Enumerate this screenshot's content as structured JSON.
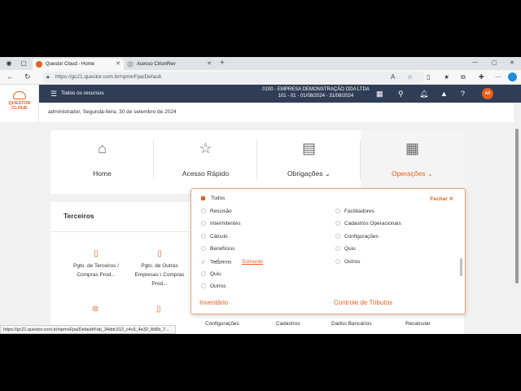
{
  "browser": {
    "tabs": [
      {
        "title": "Questor Cloud - Home",
        "active": true
      },
      {
        "title": "Acesso CirionRev",
        "active": false
      }
    ],
    "new_tab": "+",
    "url": "https://gc21.questor.com.br/npmnFpa/Default",
    "status_url": "https://gc21.questor.com.br/npmnFpa/Default#!ab_34ddc312_c4c6_4e32_8d5b_7..."
  },
  "app": {
    "logo": "QUESTOR CLOUD",
    "menu_label": "Todos os recursos",
    "company_line1": "0100 - EMPRESA DEMONSTRAÇÃO ODA LTDA",
    "company_line2": "101 - 01 - 01/08/2024 - 31/08/2024",
    "avatar": "AB",
    "user_line": "administrador, Segunda-feira, 30 de setembro de 2024",
    "accent": "#e8601c",
    "header_bg": "#2f3e57"
  },
  "cards": [
    {
      "label": "Home",
      "icon": "home-icon"
    },
    {
      "label": "Acesso Rápido",
      "icon": "star-icon"
    },
    {
      "label": "Obrigações ⌄",
      "icon": "clipboard-icon"
    },
    {
      "label": "Operações ⌄",
      "icon": "calculator-icon",
      "active": true
    }
  ],
  "panel": {
    "title": "Terceiros",
    "items": [
      {
        "label": "Pgto. de Terceiros / Compras Prod..."
      },
      {
        "label": "Pgto. de Outras Empresas \\ Compras Prod..."
      }
    ],
    "bottom_labels": [
      "Configurações",
      "Cadastros",
      "Dados Bancários",
      "Recalcular"
    ]
  },
  "dropdown": {
    "all_label": "Todos",
    "close_label": "Fechar ✕",
    "left_options": [
      "Rescisão",
      "Intermitentes",
      "Cálculo",
      "Benefícios",
      "Terceiros",
      "Quiu",
      "Outros"
    ],
    "right_options": [
      "Facilitadores",
      "Cadastros Operacionais",
      "Configurações",
      "Quiu",
      "Outros"
    ],
    "checked": "Terceiros",
    "only_label": "Somente",
    "footer_left": "Inventário",
    "footer_right": "Controle de Tributos"
  }
}
